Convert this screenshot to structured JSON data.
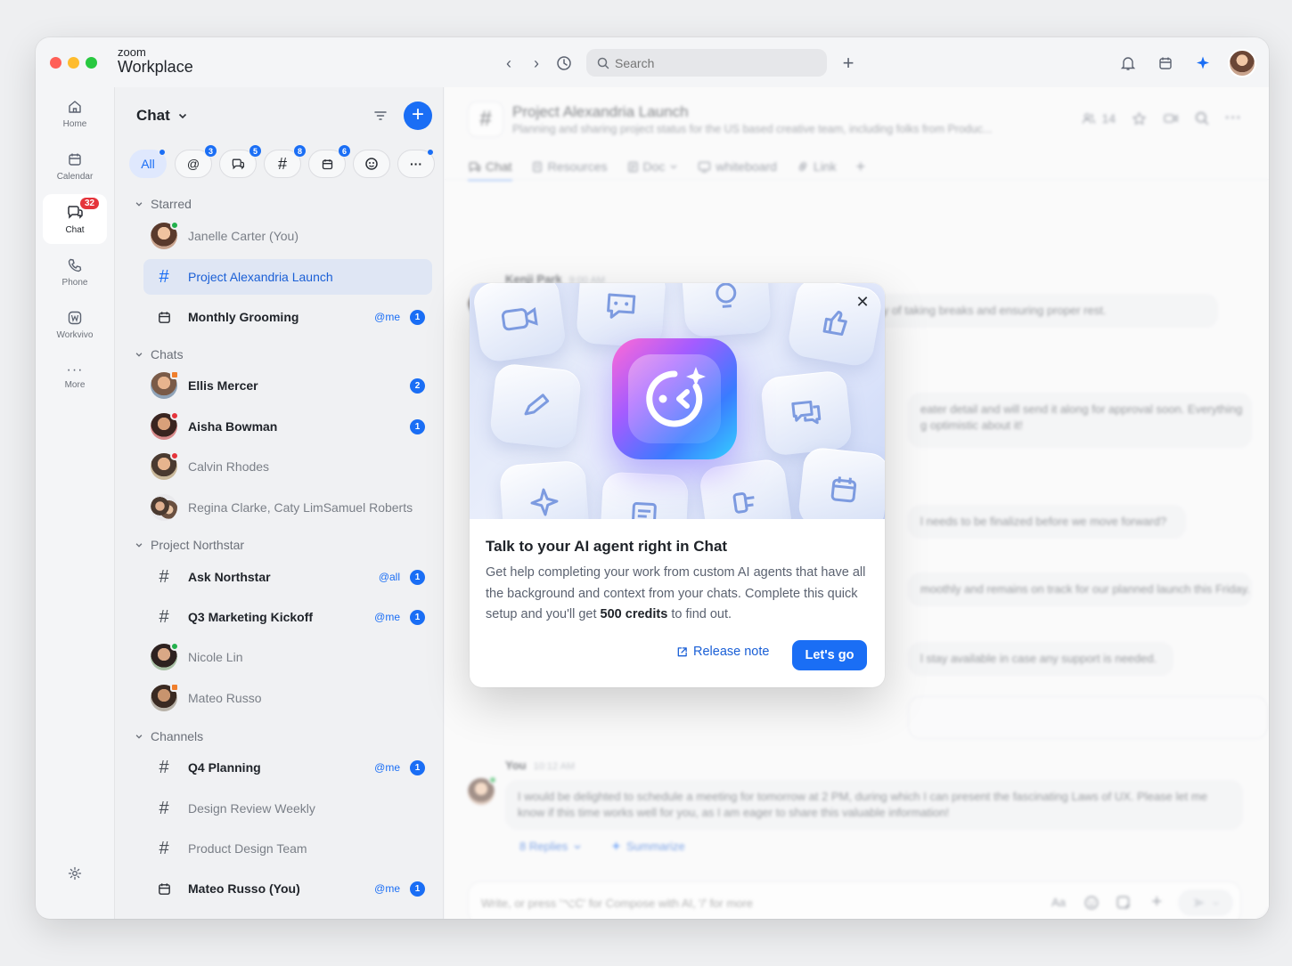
{
  "app": {
    "logo_top": "zoom",
    "logo_main": "Workplace"
  },
  "search": {
    "placeholder": "Search"
  },
  "rail": {
    "items": [
      {
        "label": "Home",
        "icon": "home-icon"
      },
      {
        "label": "Calendar",
        "icon": "calendar-icon"
      },
      {
        "label": "Chat",
        "icon": "chat-icon",
        "badge": "32"
      },
      {
        "label": "Phone",
        "icon": "phone-icon"
      },
      {
        "label": "Workvivo",
        "icon": "workvivo-icon"
      },
      {
        "label": "More",
        "icon": "more-icon"
      }
    ]
  },
  "list": {
    "header": "Chat",
    "filters": [
      {
        "label": "All",
        "active": true
      },
      {
        "label": "@",
        "badge": "3"
      },
      {
        "label": "threads",
        "badge": "5"
      },
      {
        "label": "#",
        "badge": "8"
      },
      {
        "label": "calendar",
        "badge": "6"
      },
      {
        "label": "apps"
      },
      {
        "label": "···"
      }
    ],
    "sections": {
      "starred": "Starred",
      "chats": "Chats",
      "northstar": "Project Northstar",
      "channels": "Channels"
    },
    "starred": [
      {
        "name": "Janelle Carter (You)"
      },
      {
        "name": "Project Alexandria Launch"
      },
      {
        "name": "Monthly Grooming",
        "mention": "@me",
        "count": "1"
      }
    ],
    "chats": [
      {
        "name": "Ellis Mercer",
        "count": "2"
      },
      {
        "name": "Aisha Bowman",
        "count": "1"
      },
      {
        "name": "Calvin Rhodes"
      },
      {
        "name": "Regina Clarke, Caty LimSamuel Roberts"
      }
    ],
    "northstar": [
      {
        "name": "Ask Northstar",
        "mention": "@all",
        "count": "1"
      },
      {
        "name": "Q3 Marketing Kickoff",
        "mention": "@me",
        "count": "1"
      },
      {
        "name": "Nicole Lin"
      },
      {
        "name": "Mateo Russo"
      }
    ],
    "channels": [
      {
        "name": "Q4 Planning",
        "mention": "@me",
        "count": "1"
      },
      {
        "name": "Design Review Weekly"
      },
      {
        "name": "Product Design Team"
      },
      {
        "name": "Mateo Russo (You)",
        "mention": "@me",
        "count": "1"
      }
    ]
  },
  "channel": {
    "title": "Project Alexandria Launch",
    "description": "Planning and sharing project status for the US based creative team, including folks from Produc...",
    "members": "14",
    "tabs": [
      "Chat",
      "Resources",
      "Doc",
      "whiteboard",
      "Link"
    ]
  },
  "messages": [
    {
      "author": "Kenji Park",
      "time": "9:00 AM",
      "text": "The significance of the task at hand directly correlates with the necessity of taking breaks and ensuring proper rest."
    },
    {
      "text_a": "eater detail and will send it along for approval soon. Everything",
      "text_b": "g optimistic about it!"
    },
    {
      "text": "l needs to be finalized before we move forward?"
    },
    {
      "text": "moothly and remains on track for our planned launch this Friday."
    },
    {
      "text": "l stay available in case any support is needed."
    },
    {
      "author": "You",
      "time": "10:12 AM",
      "text": "I would be delighted to schedule a meeting for tomorrow at 2 PM, during which I can present the fascinating Laws of UX. Please let me know if this time works well for you, as I am eager to share this valuable information!"
    }
  ],
  "thread": {
    "replies": "8 Replies",
    "summarize": "Summarize"
  },
  "composer": {
    "placeholder": "Write, or press '⌥C' for Compose with AI, '/' for more",
    "format_label": "Aa"
  },
  "modal": {
    "title": "Talk to your AI agent right in Chat",
    "body_a": "Get help completing your work from custom AI agents that have all the background and context from your chats. Complete this quick setup and you'll get ",
    "body_bold": "500 credits",
    "body_b": " to find out.",
    "release_note": "Release note",
    "cta": "Let's go"
  },
  "colors": {
    "accent": "#1a6ef5",
    "badge_red": "#e5343b",
    "online": "#22b14c"
  }
}
